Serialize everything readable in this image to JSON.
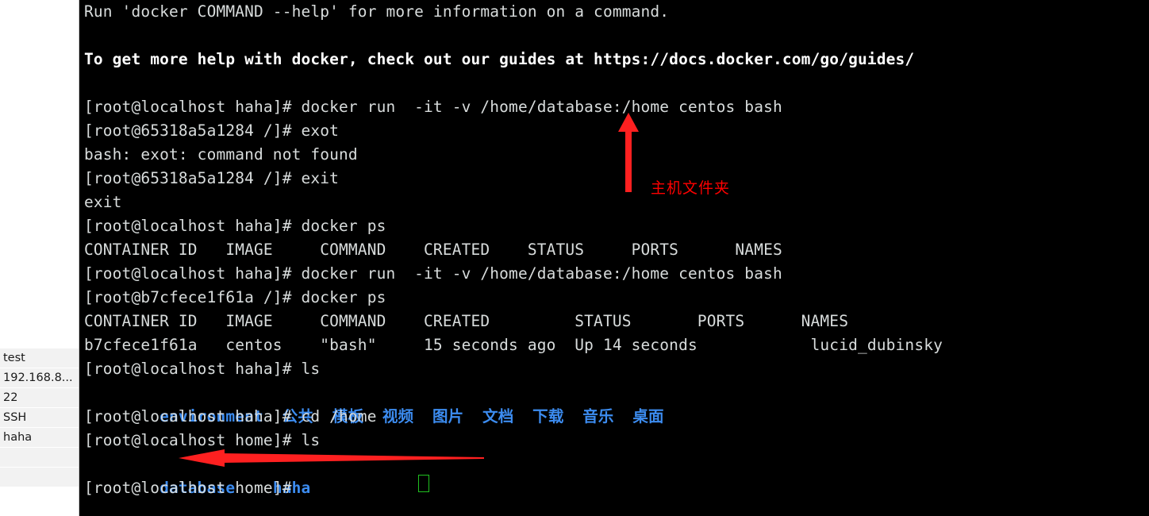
{
  "session_panel": {
    "rows": [
      {
        "label": "test"
      },
      {
        "label": "192.168.8..."
      },
      {
        "label": "22"
      },
      {
        "label": "SSH"
      },
      {
        "label": "haha"
      },
      {
        "label": ""
      },
      {
        "label": ""
      }
    ]
  },
  "terminal": {
    "prompt_host": "[root@localhost haha]#",
    "lines": [
      {
        "text": "Run 'docker COMMAND --help' for more information on a command.",
        "style": "normal"
      },
      {
        "text": "",
        "style": "normal"
      },
      {
        "text": "To get more help with docker, check out our guides at https://docs.docker.com/go/guides/",
        "style": "bold"
      },
      {
        "text": "",
        "style": "normal"
      },
      {
        "text": "[root@localhost haha]# docker run  -it -v /home/database:/home centos bash",
        "style": "normal"
      },
      {
        "text": "[root@65318a5a1284 /]# exot",
        "style": "normal"
      },
      {
        "text": "bash: exot: command not found",
        "style": "normal"
      },
      {
        "text": "[root@65318a5a1284 /]# exit",
        "style": "normal"
      },
      {
        "text": "exit",
        "style": "normal"
      },
      {
        "text": "[root@localhost haha]# docker ps",
        "style": "normal"
      },
      {
        "text": "CONTAINER ID   IMAGE     COMMAND    CREATED    STATUS     PORTS      NAMES",
        "style": "normal"
      },
      {
        "text": "[root@localhost haha]# docker run  -it -v /home/database:/home centos bash",
        "style": "normal"
      },
      {
        "text": "[root@b7cfece1f61a /]# docker ps",
        "style": "normal"
      },
      {
        "text": "CONTAINER ID   IMAGE     COMMAND    CREATED         STATUS       PORTS      NAMES",
        "style": "normal"
      },
      {
        "text": "b7cfece1f61a   centos    \"bash\"     15 seconds ago  Up 14 seconds            lucid_dubinsky",
        "style": "normal"
      },
      {
        "text": "[root@localhost haha]# ls",
        "style": "normal"
      },
      {
        "text": "LS_OUTPUT_HOME",
        "style": "special-ls-home"
      },
      {
        "text": "[root@localhost haha]# cd /home",
        "style": "normal"
      },
      {
        "text": "[root@localhost home]# ls",
        "style": "normal"
      },
      {
        "text": "LS_OUTPUT_DB",
        "style": "special-ls-db"
      },
      {
        "text": "[root@localhost home]# ",
        "style": "normal"
      }
    ],
    "ls_home_entries": [
      "environment",
      "公共",
      "模板",
      "视频",
      "图片",
      "文档",
      "下载",
      "音乐",
      "桌面"
    ],
    "ls_home_rendered": "environment  公共  模板  视频  图片  文档  下载  音乐  桌面",
    "ls_home_dir_color": "#3c8cf0",
    "ls_db_entries": [
      "database",
      "haha"
    ],
    "ls_db_rendered": "database  haha",
    "docker_ps_first": {
      "headers": [
        "CONTAINER ID",
        "IMAGE",
        "COMMAND",
        "CREATED",
        "STATUS",
        "PORTS",
        "NAMES"
      ],
      "rows": []
    },
    "docker_ps_second": {
      "headers": [
        "CONTAINER ID",
        "IMAGE",
        "COMMAND",
        "CREATED",
        "STATUS",
        "PORTS",
        "NAMES"
      ],
      "rows": [
        [
          "b7cfece1f61a",
          "centos",
          "\"bash\"",
          "15 seconds ago",
          "Up 14 seconds",
          "",
          "lucid_dubinsky"
        ]
      ]
    },
    "cursor": {
      "shape": "hollow-block",
      "color": "#20c020"
    },
    "background": "#000000",
    "foreground": "#d8dcdc"
  },
  "annotations": {
    "host_folder_label": "主机文件夹",
    "color": "#fe0000",
    "up_arrow_name": "points to /home/database host path",
    "left_arrow_name": "points to haha directory"
  }
}
